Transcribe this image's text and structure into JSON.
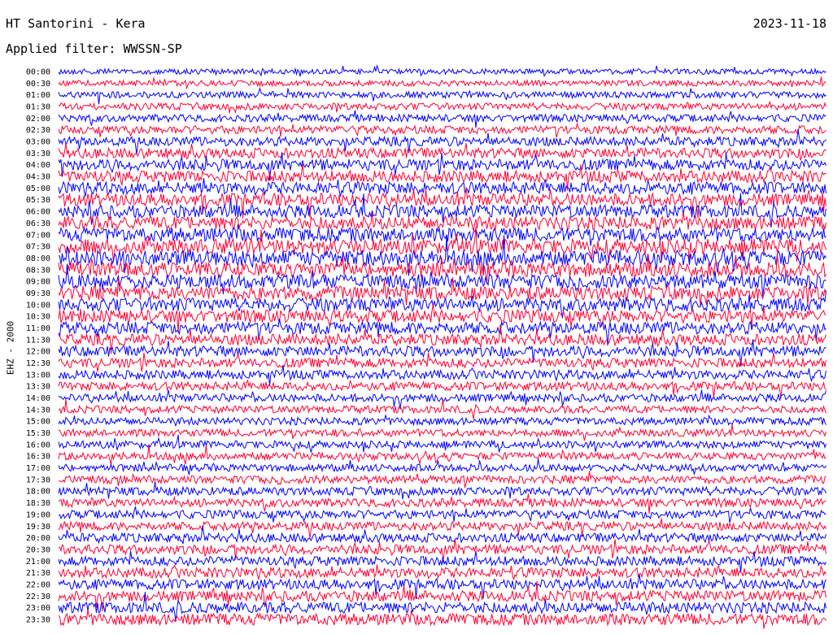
{
  "header": {
    "station": "HT Santorini - Kera",
    "date": "2023-11-18",
    "filter": "Applied filter: WWSSN-SP",
    "channel": "EHZ - 2000"
  },
  "chart_data": {
    "type": "line",
    "subtype": "helicorder",
    "title": "HT Santorini - Kera",
    "date": "2023-11-18",
    "filter": "WWSSN-SP",
    "ylabel": "EHZ - 2000",
    "row_labels": [
      "00:00",
      "00:30",
      "01:00",
      "01:30",
      "02:00",
      "02:30",
      "03:00",
      "03:30",
      "04:00",
      "04:30",
      "05:00",
      "05:30",
      "06:00",
      "06:30",
      "07:00",
      "07:30",
      "08:00",
      "08:30",
      "09:00",
      "09:30",
      "10:00",
      "10:30",
      "11:00",
      "11:30",
      "12:00",
      "12:30",
      "13:00",
      "13:30",
      "14:00",
      "14:30",
      "15:00",
      "15:30",
      "16:00",
      "16:30",
      "17:00",
      "17:30",
      "18:00",
      "18:30",
      "19:00",
      "19:30",
      "20:00",
      "20:30",
      "21:00",
      "21:30",
      "22:00",
      "22:30",
      "23:00",
      "23:30"
    ],
    "row_amplitude": [
      0.5,
      0.55,
      0.6,
      0.65,
      0.7,
      0.75,
      0.85,
      0.95,
      1.05,
      1.1,
      1.15,
      1.2,
      1.2,
      1.25,
      1.3,
      1.4,
      1.45,
      1.4,
      1.35,
      1.3,
      1.25,
      1.2,
      1.15,
      1.05,
      1.0,
      0.9,
      0.85,
      0.8,
      0.75,
      0.7,
      0.7,
      0.7,
      0.7,
      0.7,
      0.7,
      0.75,
      0.8,
      0.8,
      0.8,
      0.8,
      0.85,
      0.9,
      0.9,
      0.95,
      0.95,
      1.0,
      1.05,
      1.1
    ],
    "colors": [
      "#0000ff",
      "#ff0033"
    ],
    "grid": false
  }
}
